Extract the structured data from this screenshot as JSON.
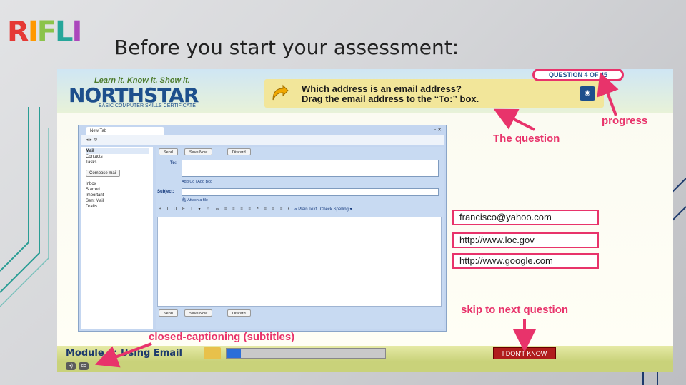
{
  "logo": [
    "R",
    "I",
    "F",
    "L",
    "I"
  ],
  "slide_title": "Before you start your assessment:",
  "northstar": {
    "tagline": "Learn it. Know it. Show it.",
    "brand": "NORTHSTAR",
    "subtitle": "BASIC COMPUTER SKILLS CERTIFICATE",
    "question_counter": "QUESTION 4 OF 45",
    "question_line1": "Which address is an email address?",
    "question_line2": "Drag the email address to the “To:” box.",
    "module_title": "Module 4: Using Email",
    "progress_fraction": 0.09,
    "dont_know_label": "I DON'T KNOW",
    "answers": [
      "francisco@yahoo.com",
      "http://www.loc.gov",
      "http://www.google.com"
    ]
  },
  "browser": {
    "tab_label": "New Tab",
    "sidebar": {
      "items": [
        "Mail",
        "Contacts",
        "Tasks"
      ],
      "compose_label": "Compose mail",
      "folders": [
        "Inbox",
        "Starred",
        "Important",
        "Sent Mail",
        "Drafts"
      ]
    },
    "compose": {
      "send_label": "Send",
      "save_label": "Save Now",
      "discard_label": "Discard",
      "to_label": "To:",
      "cc_bcc_label": "Add Cc | Add Bcc",
      "subject_label": "Subject:",
      "attach_label": "Attach a file",
      "plain_text_label": "« Plain Text",
      "spell_label": "Check Spelling ▾"
    }
  },
  "annotations": {
    "progress": "progress",
    "question": "The question",
    "skip": "skip to next question",
    "captions": "closed-captioning (subtitles)"
  },
  "colors": {
    "accent": "#e8336b",
    "navy": "#1d4f8c",
    "question_bg": "#f2e69a"
  }
}
